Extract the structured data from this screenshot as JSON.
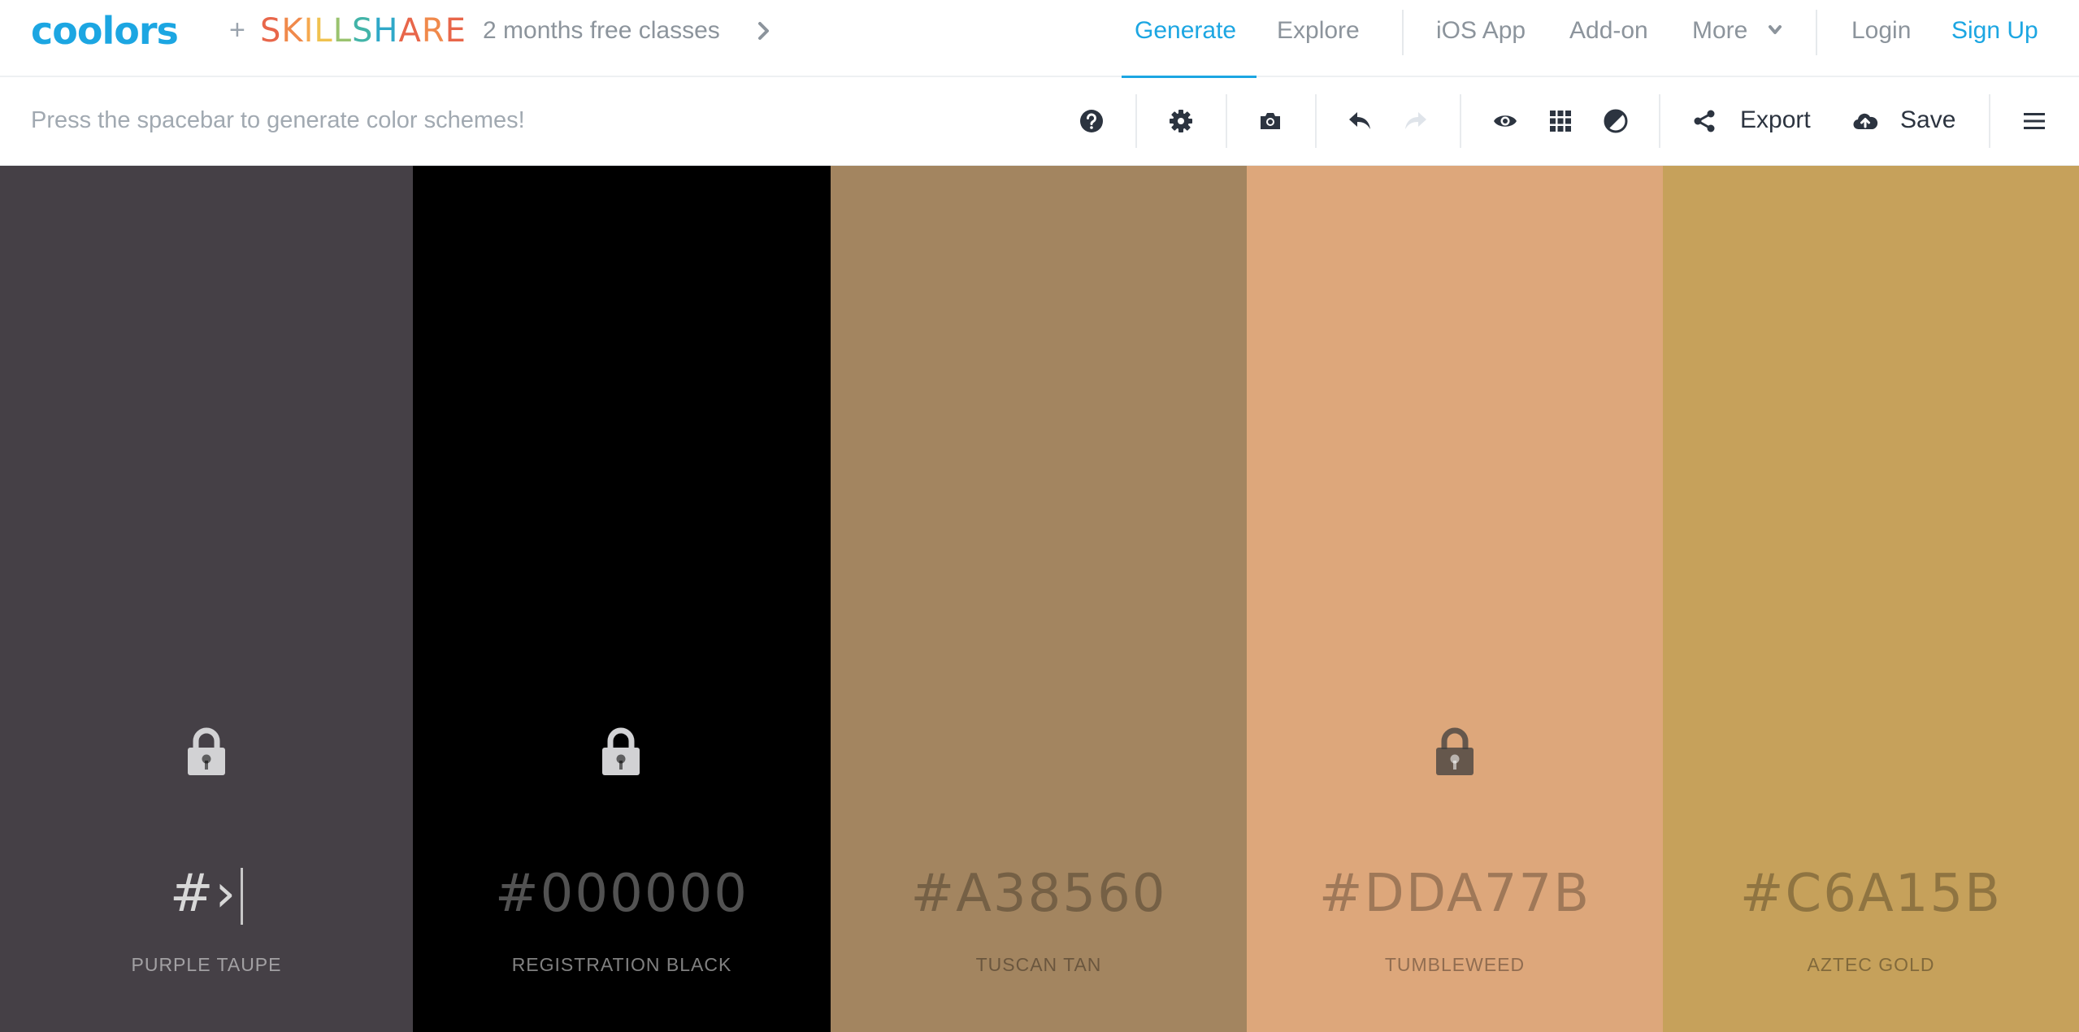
{
  "nav": {
    "logo": "coolors",
    "plus": "+",
    "skillshare_letters": [
      {
        "ch": "S",
        "color": "#e8664a"
      },
      {
        "ch": "K",
        "color": "#f0894b"
      },
      {
        "ch": "I",
        "color": "#f6a84e"
      },
      {
        "ch": "L",
        "color": "#f0c24f"
      },
      {
        "ch": "L",
        "color": "#9ac36f"
      },
      {
        "ch": "S",
        "color": "#42b4a8"
      },
      {
        "ch": "H",
        "color": "#2fa8c8"
      },
      {
        "ch": "A",
        "color": "#e8664a"
      },
      {
        "ch": "R",
        "color": "#f0894b"
      },
      {
        "ch": "E",
        "color": "#e8664a"
      }
    ],
    "promo": "2 months free classes",
    "links": {
      "generate": "Generate",
      "explore": "Explore",
      "ios_app": "iOS App",
      "addon": "Add-on",
      "more": "More",
      "login": "Login",
      "signup": "Sign Up"
    },
    "accent": "#1ca6e2"
  },
  "toolbar": {
    "hint": "Press the spacebar to generate color schemes!",
    "export_label": "Export",
    "save_label": "Save",
    "icons": [
      "help-icon",
      "gear-icon",
      "camera-icon",
      "undo-icon",
      "redo-icon",
      "eye-icon",
      "grid-icon",
      "contrast-icon",
      "share-icon",
      "upload-cloud-icon",
      "hamburger-menu-icon"
    ]
  },
  "palette": {
    "colors": [
      {
        "hex": "#›",
        "name": "PURPLE TAUPE",
        "bg": "#454046",
        "locked": true,
        "editing": true
      },
      {
        "hex": "#000000",
        "name": "REGISTRATION BLACK",
        "bg": "#000000",
        "locked": true,
        "editing": false
      },
      {
        "hex": "#A38560",
        "name": "TUSCAN TAN",
        "bg": "#a38560",
        "locked": false,
        "editing": false
      },
      {
        "hex": "#DDA77B",
        "name": "TUMBLEWEED",
        "bg": "#dda77b",
        "locked": true,
        "editing": false
      },
      {
        "hex": "#C6A15B",
        "name": "AZTEC GOLD",
        "bg": "#c6a15b",
        "locked": false,
        "editing": false
      }
    ]
  }
}
